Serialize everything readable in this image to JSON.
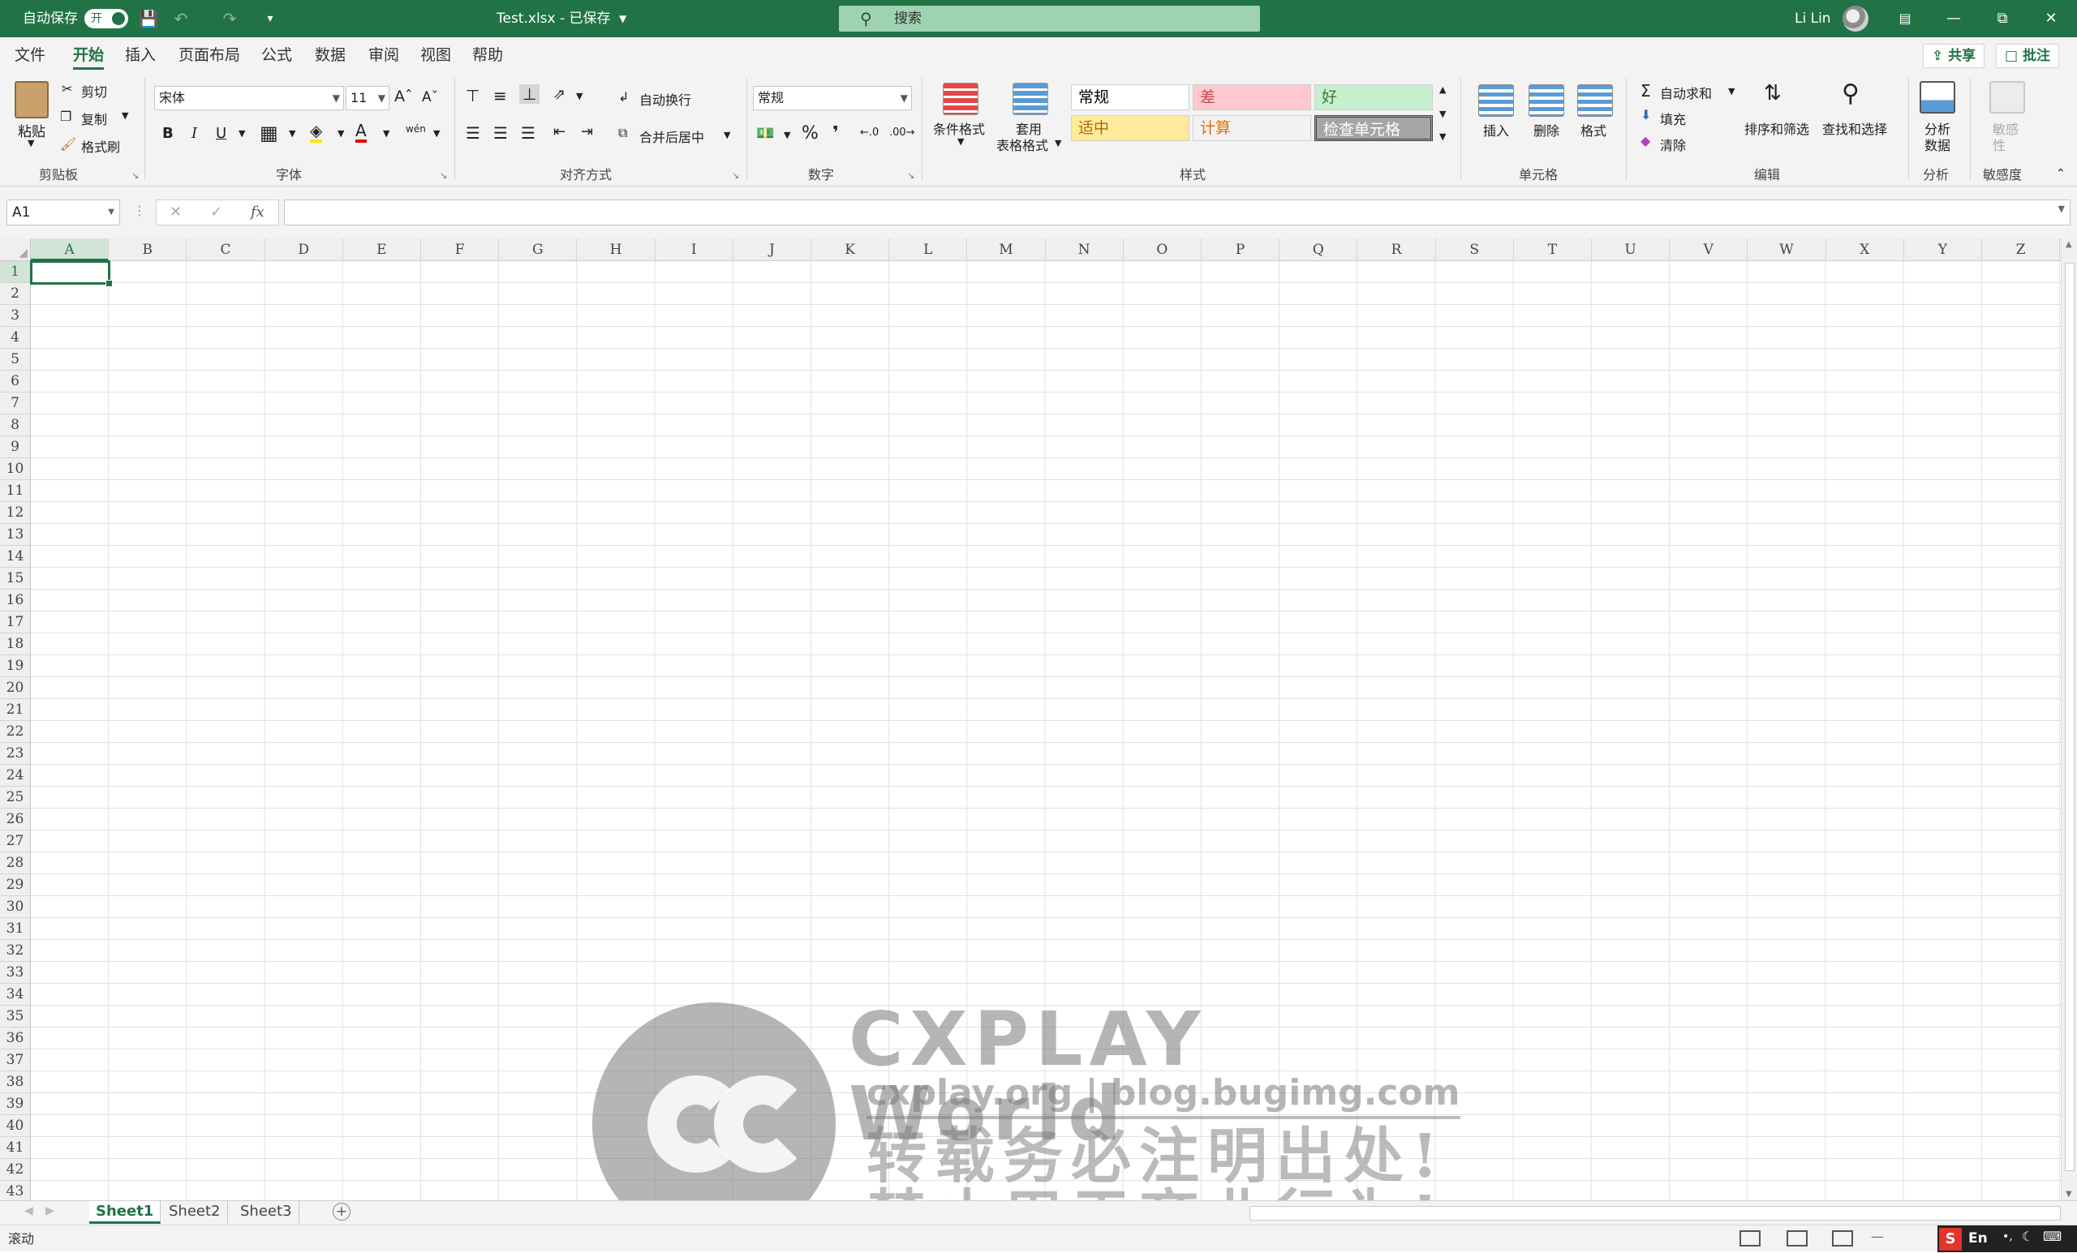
{
  "titlebar": {
    "autosave_label": "自动保存",
    "autosave_state": "开",
    "file_title": "Test.xlsx  -  已保存",
    "search_placeholder": "搜索",
    "user_name": "Li Lin"
  },
  "menu": {
    "tabs": [
      "文件",
      "开始",
      "插入",
      "页面布局",
      "公式",
      "数据",
      "审阅",
      "视图",
      "帮助"
    ],
    "active_tab": "开始",
    "share_label": "共享",
    "comment_label": "批注"
  },
  "ribbon": {
    "clipboard": {
      "paste": "粘贴",
      "cut": "剪切",
      "copy": "复制",
      "format_painter": "格式刷",
      "group": "剪贴板"
    },
    "font": {
      "font_name": "宋体",
      "font_size": "11",
      "bold": "B",
      "italic": "I",
      "underline": "U",
      "phonetic": "wén",
      "group": "字体"
    },
    "alignment": {
      "wrap_text": "自动换行",
      "merge_center": "合并后居中",
      "group": "对齐方式"
    },
    "number": {
      "format": "常规",
      "percent": "%",
      "comma": "❜",
      "group": "数字"
    },
    "styles": {
      "conditional": "条件格式",
      "format_table_line1": "套用",
      "format_table_line2": "表格格式",
      "cells": [
        {
          "label": "常规",
          "bg": "#ffffff",
          "fg": "#000000"
        },
        {
          "label": "差",
          "bg": "#ffc7ce",
          "fg": "#c0504d"
        },
        {
          "label": "好",
          "bg": "#c6efce",
          "fg": "#3b7a3b"
        },
        {
          "label": "适中",
          "bg": "#ffeb9c",
          "fg": "#b06a00"
        },
        {
          "label": "计算",
          "bg": "#f2f2f2",
          "fg": "#e07000"
        },
        {
          "label": "检查单元格",
          "bg": "#a5a5a5",
          "fg": "#ffffff"
        }
      ],
      "group": "样式"
    },
    "cells_group": {
      "insert": "插入",
      "delete": "删除",
      "format": "格式",
      "group": "单元格"
    },
    "editing": {
      "autosum": "自动求和",
      "fill": "填充",
      "clear": "清除",
      "sort_filter": "排序和筛选",
      "find_select": "查找和选择",
      "group": "编辑"
    },
    "analysis": {
      "analyze_line1": "分析",
      "analyze_line2": "数据",
      "group": "分析"
    },
    "sensitivity": {
      "label_line1": "敏感",
      "label_line2": "性",
      "group": "敏感度"
    }
  },
  "formula_bar": {
    "name_box": "A1",
    "fx": "fx",
    "cancel": "✕",
    "enter": "✓",
    "formula": ""
  },
  "grid": {
    "columns": [
      "A",
      "B",
      "C",
      "D",
      "E",
      "F",
      "G",
      "H",
      "I",
      "J",
      "K",
      "L",
      "M",
      "N",
      "O",
      "P",
      "Q",
      "R",
      "S",
      "T",
      "U",
      "V",
      "W",
      "X",
      "Y",
      "Z"
    ],
    "rows": [
      "1",
      "2",
      "3",
      "4",
      "5",
      "6",
      "7",
      "8",
      "9",
      "10",
      "11",
      "12",
      "13",
      "14",
      "15",
      "16",
      "17",
      "18",
      "19",
      "20",
      "21",
      "22",
      "23",
      "24",
      "25",
      "26",
      "27",
      "28",
      "29",
      "30",
      "31",
      "32",
      "33",
      "34",
      "35",
      "36",
      "37",
      "38",
      "39",
      "40",
      "41",
      "42",
      "43"
    ],
    "selected_cell": "A1"
  },
  "watermark": {
    "title": "CXPLAY World",
    "url": "cxplay.org | blog.bugimg.com",
    "line1": "转载务必注明出处!",
    "line2": "禁止用于商业行为!"
  },
  "sheets": {
    "tabs": [
      "Sheet1",
      "Sheet2",
      "Sheet3"
    ],
    "active": "Sheet1"
  },
  "statusbar": {
    "mode": "滚动",
    "ime": "En"
  }
}
